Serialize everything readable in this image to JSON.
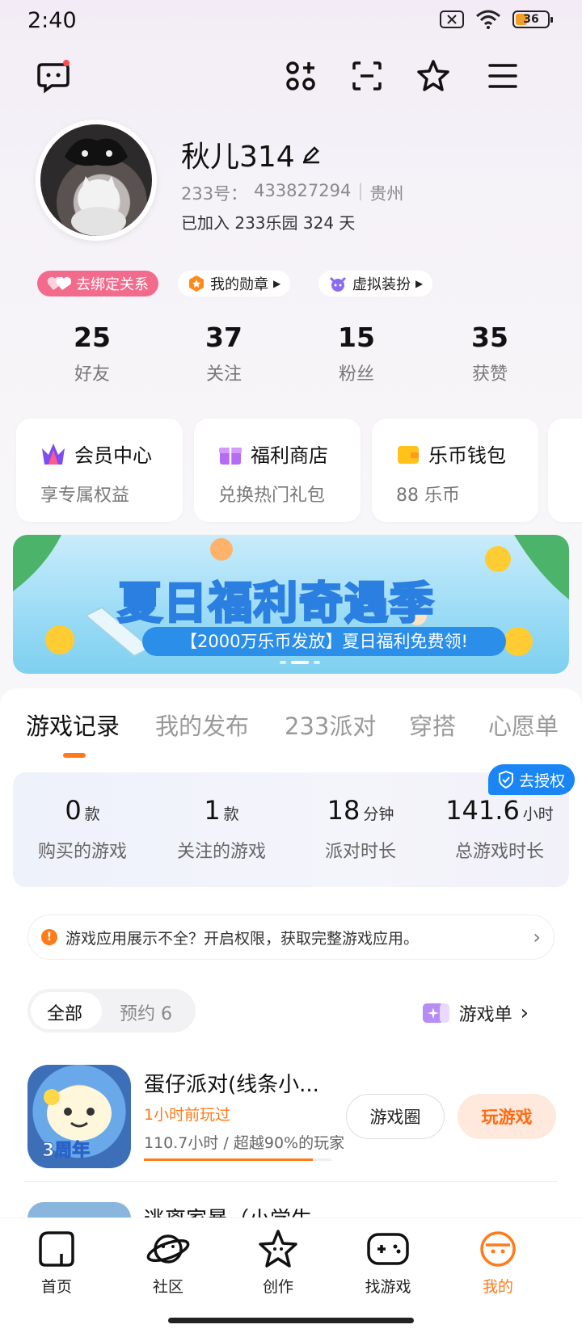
{
  "status_bar": {
    "time": "2:40",
    "battery": "36"
  },
  "profile": {
    "name": "秋儿314",
    "id_label": "233号：",
    "id_value": "433827294",
    "location": "贵州",
    "joined": "已加入 233乐园 324 天"
  },
  "pills": {
    "bind": "去绑定关系",
    "medal": "我的勋章",
    "dress": "虚拟装扮"
  },
  "stats": [
    {
      "num": "25",
      "label": "好友"
    },
    {
      "num": "37",
      "label": "关注"
    },
    {
      "num": "15",
      "label": "粉丝"
    },
    {
      "num": "35",
      "label": "获赞"
    }
  ],
  "cards": [
    {
      "title": "会员中心",
      "sub": "享专属权益"
    },
    {
      "title": "福利商店",
      "sub": "兑换热门礼包"
    },
    {
      "title": "乐币钱包",
      "sub": "88 乐币"
    }
  ],
  "banner": {
    "title": "夏日福利奇遇季",
    "sub": "【2000万乐币发放】夏日福利免费领!"
  },
  "tabs": [
    "游戏记录",
    "我的发布",
    "233派对",
    "穿搭",
    "心愿单"
  ],
  "auth_badge": "去授权",
  "game_stats": [
    {
      "value": "0",
      "unit": "款",
      "label": "购买的游戏"
    },
    {
      "value": "1",
      "unit": "款",
      "label": "关注的游戏"
    },
    {
      "value": "18",
      "unit": "分钟",
      "label": "派对时长"
    },
    {
      "value": "141.6",
      "unit": "小时",
      "label": "总游戏时长"
    }
  ],
  "notice": "游戏应用展示不全？开启权限，获取完整游戏应用。",
  "filter": {
    "all": "全部",
    "reserved": "预约 6",
    "gamelist": "游戏单"
  },
  "game": {
    "title": "蛋仔派对(线条小...",
    "played": "1小时前玩过",
    "hours": "110.7小时 / 超越90%的玩家",
    "progress": 0.9,
    "circle_btn": "游戏圈",
    "play_btn": "玩游戏",
    "icon_text": "3周年"
  },
  "game2": {
    "title": "逃离家暴（小学生"
  },
  "nav": [
    "首页",
    "社区",
    "创作",
    "找游戏",
    "我的"
  ],
  "colors": {
    "accent": "#ff7a1a",
    "blue": "#1a86f5"
  }
}
